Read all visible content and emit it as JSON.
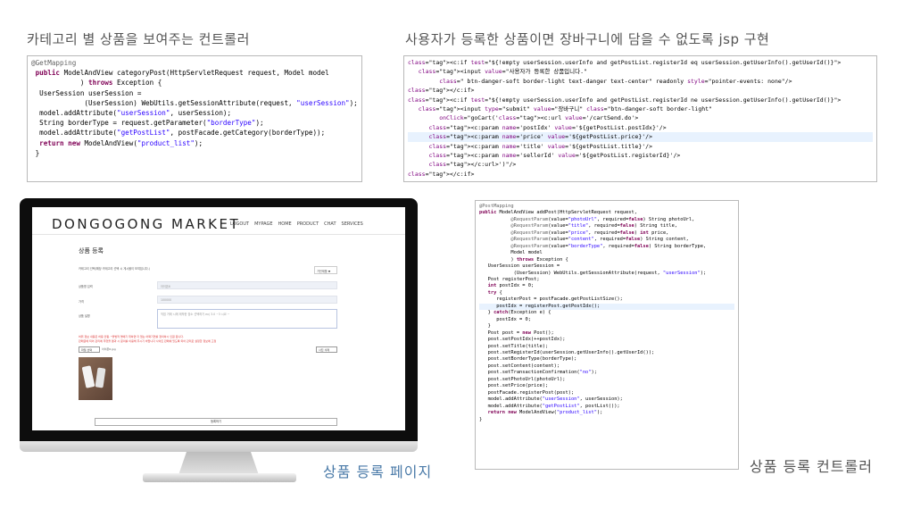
{
  "headings": {
    "category_controller": "카테고리 별 상품을 보여주는 컨트롤러",
    "jsp_impl": "사용자가 등록한 상품이면 장바구니에 담을 수 없도록 jsp 구현"
  },
  "captions": {
    "register_page": "상품 등록 페이지",
    "register_controller": "상품 등록 컨트롤러"
  },
  "colors": {
    "caption_blue": "#4a7aa8",
    "caption_gray": "#555555"
  },
  "website": {
    "logo": "DONGOGONG MARKET",
    "nav": [
      "LOGOUT",
      "MYPAGE",
      "HOME",
      "PRODUCT",
      "CHAT",
      "SERVICES"
    ],
    "form_title": "상품 등록",
    "category_hint": "카테고리 선택(해당 카테고리 선택 시 게시물이 보여집니다.)",
    "category_select": "가전제품 ▼",
    "labels": {
      "product_name": "상품명 입력",
      "price": "가격",
      "description": "상품 설명"
    },
    "placeholders": {
      "product_name": "아이폰6",
      "price": "100000",
      "description": "직접 거래 시에 제작한 장소 선택하기 ex) 3.0 ~3 시요 ~"
    },
    "notes": [
      "허위 정보 내용은 허용 안됨. *불법적 명에기 위하면 더 엄는 어쩌기연를 정의하시 인원 됩니다.",
      "판매글에 되어 관리에 뚜렷을 결과 시 문의를 이용해 주시기 바랍니다 사이트 판매에 있도록 되어 관리로 설정한 정보에 고정"
    ],
    "file_button": "파일 선택",
    "file_name": "아이폰6.jpg",
    "delete_button": "사진 삭제",
    "submit_button": "등록하기"
  },
  "code": {
    "category_controller": [
      "@GetMapping",
      "public ModelAndView categoryPost(HttpServletRequest request, Model model",
      ") throws Exception {",
      "UserSession userSession =",
      "(UserSession) WebUtils.getSessionAttribute(request, \"userSession\");",
      "model.addAttribute(\"userSession\", userSession);",
      "String borderType = request.getParameter(\"borderType\");",
      "model.addAttribute(\"getPostList\", postFacade.getCategory(borderType));",
      "return new ModelAndView(\"product_list\");",
      "}"
    ],
    "jsp": [
      "<c:if test=\"${!empty userSession.userInfo and getPostList.registerId eq userSession.getUserInfo().getUserId()}\">",
      "<input value=\"사용자가 등록한 상품입니다.\"",
      "class=\" btn-danger-soft border-light text-danger text-center\" readonly style=\"pointer-events: none\"/>",
      "</c:if>",
      "<c:if test=\"${!empty userSession.userInfo and getPostList.registerId ne userSession.getUserInfo().getUserId()}\">",
      "<input type=\"submit\" value=\"장바구니\" class=\"btn-danger-soft border-light\"",
      "onClick=\"goCart('<c:url value='/cartSend.do'>",
      "<c:param name='postIdx' value='${getPostList.postIdx}'/>",
      "<c:param name='price' value='${getPostList.price}'/>",
      "<c:param name='title' value='${getPostList.title}'/>",
      "<c:param name='sellerId' value='${getPostList.registerId}'/>",
      "</c:url>')\"/>",
      "</c:if>"
    ],
    "register_controller": [
      "@PostMapping",
      "public ModelAndView addPost(HttpServletRequest request,",
      "@RequestParam(value=\"photoUrl\", required=false) String photoUrl,",
      "@RequestParam(value=\"title\", required=false) String title,",
      "@RequestParam(value=\"price\", required=false) int price,",
      "@RequestParam(value=\"content\", required=false) String content,",
      "@RequestParam(value=\"borderType\", required=false) String borderType,",
      "Model model",
      ") throws Exception {",
      "UserSession userSession =",
      "(UserSession) WebUtils.getSessionAttribute(request, \"userSession\");",
      "",
      "Post registerPost;",
      "int postIdx = 0;",
      "try {",
      "registerPost = postFacade.getPostListSize();",
      "postIdx = registerPost.getPostIdx();",
      "} catch(Exception e) {",
      "postIdx = 0;",
      "}",
      "",
      "Post post = new Post();",
      "post.setPostIdx(++postIdx);",
      "post.setTitle(title);",
      "post.setRegisterId(userSession.getUserInfo().getUserId());",
      "post.setBorderType(borderType);",
      "post.setContent(content);",
      "post.setTransactionConfirmation(\"no\");",
      "post.setPhotoUrl(photoUrl);",
      "post.setPrice(price);",
      "",
      "postFacade.registerPost(post);",
      "",
      "model.addAttribute(\"userSession\", userSession);",
      "model.addAttribute(\"getPostList\", postList());",
      "",
      "return new ModelAndView(\"product_list\");",
      "}"
    ]
  }
}
